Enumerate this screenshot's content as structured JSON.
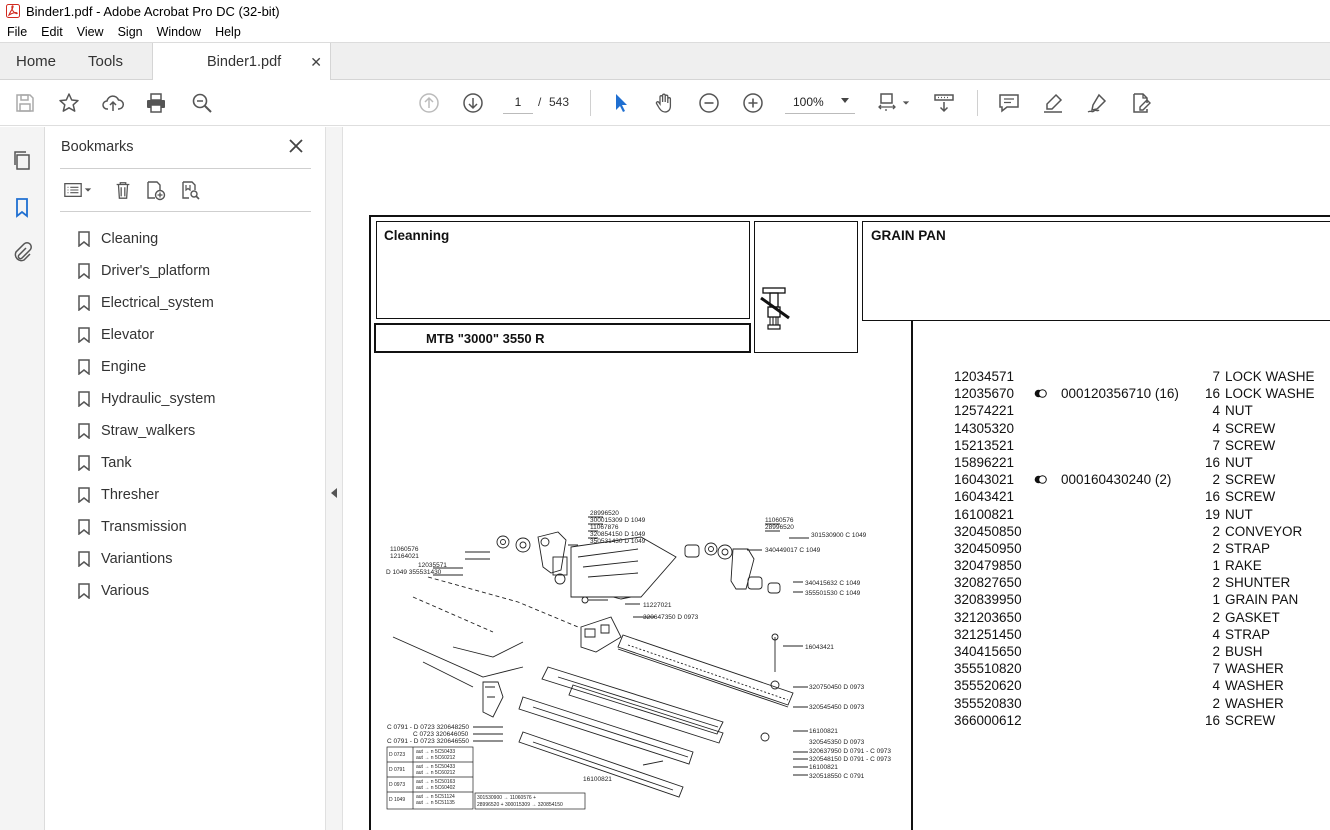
{
  "window": {
    "title": "Binder1.pdf - Adobe Acrobat Pro DC (32-bit)"
  },
  "menu": [
    "File",
    "Edit",
    "View",
    "Sign",
    "Window",
    "Help"
  ],
  "tabs": {
    "home": "Home",
    "tools": "Tools",
    "document": "Binder1.pdf"
  },
  "toolbar": {
    "current_page": "1",
    "page_separator": "/",
    "total_pages": "543",
    "zoom": "100%"
  },
  "bookmarks": {
    "title": "Bookmarks",
    "items": [
      "Cleaning",
      "Driver's_platform",
      "Electrical_system",
      "Elevator",
      "Engine",
      "Hydraulic_system",
      "Straw_walkers",
      "Tank",
      "Thresher",
      "Transmission",
      "Variantions",
      "Various"
    ]
  },
  "document": {
    "section": "Cleanning",
    "model": "MTB \"3000\" 3550 R",
    "group": "GRAIN PAN",
    "parts": [
      {
        "number": "12034571",
        "alt": "",
        "qty": "7",
        "desc": "LOCK WASHE"
      },
      {
        "number": "12035670",
        "alt": "000120356710  (16)",
        "qty": "16",
        "desc": "LOCK WASHE"
      },
      {
        "number": "12574221",
        "alt": "",
        "qty": "4",
        "desc": "NUT"
      },
      {
        "number": "14305320",
        "alt": "",
        "qty": "4",
        "desc": "SCREW"
      },
      {
        "number": "15213521",
        "alt": "",
        "qty": "7",
        "desc": "SCREW"
      },
      {
        "number": "15896221",
        "alt": "",
        "qty": "16",
        "desc": "NUT"
      },
      {
        "number": "16043021",
        "alt": "000160430240  (2)",
        "qty": "2",
        "desc": "SCREW"
      },
      {
        "number": "16043421",
        "alt": "",
        "qty": "16",
        "desc": "SCREW"
      },
      {
        "number": "16100821",
        "alt": "",
        "qty": "19",
        "desc": "NUT"
      },
      {
        "number": "320450850",
        "alt": "",
        "qty": "2",
        "desc": "CONVEYOR"
      },
      {
        "number": "320450950",
        "alt": "",
        "qty": "2",
        "desc": "STRAP"
      },
      {
        "number": "320479850",
        "alt": "",
        "qty": "1",
        "desc": "RAKE"
      },
      {
        "number": "320827650",
        "alt": "",
        "qty": "2",
        "desc": "SHUNTER"
      },
      {
        "number": "320839950",
        "alt": "",
        "qty": "1",
        "desc": "GRAIN PAN"
      },
      {
        "number": "321203650",
        "alt": "",
        "qty": "2",
        "desc": "GASKET"
      },
      {
        "number": "321251450",
        "alt": "",
        "qty": "4",
        "desc": "STRAP"
      },
      {
        "number": "340415650",
        "alt": "",
        "qty": "2",
        "desc": "BUSH"
      },
      {
        "number": "355510820",
        "alt": "",
        "qty": "7",
        "desc": "WASHER"
      },
      {
        "number": "355520620",
        "alt": "",
        "qty": "4",
        "desc": "WASHER"
      },
      {
        "number": "355520830",
        "alt": "",
        "qty": "2",
        "desc": "WASHER"
      },
      {
        "number": "366000612",
        "alt": "",
        "qty": "16",
        "desc": "SCREW"
      }
    ],
    "diagram_labels": [
      "28996520",
      "300015309 D 1049",
      "11067876",
      "320854150 D 1049",
      "350531430 D 1049",
      "11060576",
      "12164021",
      "12035571",
      "D 1049 355531430",
      "11227021",
      "320647350 D 0973",
      "11060576",
      "28996520",
      "301530900 C 1049",
      "340449017 C 1049",
      "340415632 C 1049",
      "355501530 C 1049",
      "16043421",
      "320750450 D 0973",
      "320545450 D 0973",
      "16100821",
      "320545350 D 0973",
      "320637950 D 0791 - C 0973",
      "320548150 D 0791 - C 0973",
      "16100821",
      "320518550 C 0791",
      "16100821",
      "C 0791 - D 0723 320648250",
      "C 0723 320646050",
      "C 0791 - D 0723 320646550"
    ]
  }
}
